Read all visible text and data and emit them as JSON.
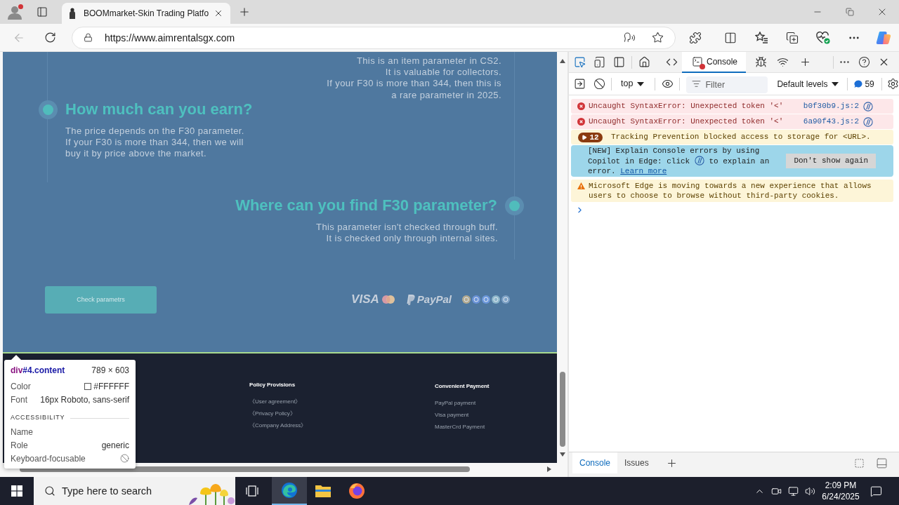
{
  "browser": {
    "tabs": [
      {
        "title": "BOOMmarket-Skin Trading Platfo",
        "selected": true
      }
    ],
    "url": "https://www.aimrentalsgx.com"
  },
  "page": {
    "intro": [
      "This is an item parameter in CS2.",
      "It is valuable for collectors.",
      "If your F30 is more than 344, then this is",
      "a rare parameter in 2025."
    ],
    "sections": [
      {
        "kind": "left",
        "title": "How much can you earn?",
        "lines": [
          "The price depends on the F30 parameter.",
          "If your F30 is more than 344, then we will",
          "buy it by price above the market."
        ]
      },
      {
        "kind": "right",
        "title": "Where can you find F30 parameter?",
        "lines": [
          "This parameter isn't checked through buff.",
          "It is checked only through internal sites."
        ]
      }
    ],
    "button": "Check parametrs",
    "payment_logos": [
      {
        "kind": "visa",
        "label": "VISA"
      },
      {
        "kind": "mastercard"
      },
      {
        "kind": "paypal",
        "label": "PayPal"
      },
      {
        "kind": "crypto"
      }
    ],
    "footer": [
      {
        "title": "Policy Provisions",
        "links": [
          "《User agreement》",
          "《Privacy Policy》",
          "《Company Address》"
        ]
      },
      {
        "title": "Convenient Payment",
        "links": [
          "PayPal payment",
          "Visa payment",
          "MasterCrd Payment"
        ]
      }
    ]
  },
  "inspect_tooltip": {
    "tag": "div",
    "selector": "#4.content",
    "size": "789 × 603",
    "styles": [
      {
        "label": "Color",
        "value": "#FFFFFF",
        "kind": "swatch"
      },
      {
        "label": "Font",
        "value": "16px Roboto, sans-serif",
        "kind": "text"
      }
    ],
    "section": "ACCESSIBILITY",
    "accessibility": [
      {
        "label": "Name",
        "kind": "text"
      },
      {
        "label": "Role",
        "value": "generic",
        "kind": "text"
      },
      {
        "label": "Keyboard-focusable",
        "kind": "blocked"
      }
    ]
  },
  "devtools": {
    "tabs": [
      {
        "label": "Console",
        "selected": true
      }
    ],
    "context": "top",
    "filter": {
      "placeholder": "Filter"
    },
    "levels": "Default levels",
    "message_count": "59",
    "messages": [
      {
        "kind": "error",
        "text": "Uncaught SyntaxError: Unexpected token '<'",
        "source": "b0f30b9.js:2"
      },
      {
        "kind": "error",
        "text": "Uncaught SyntaxError: Unexpected token '<'",
        "source": "6a90f43.js:2"
      },
      {
        "kind": "group",
        "count": "12",
        "text": "Tracking Prevention blocked access to storage for <URL>."
      },
      {
        "kind": "promo",
        "text": "[NEW] Explain Console errors by using Copilot in Edge: click",
        "text_after": "to explain an error.",
        "link": "Learn more",
        "button": "Don't show again"
      },
      {
        "kind": "warning",
        "text": "Microsoft Edge is moving towards a new experience that allows users to choose to browse without third-party cookies."
      }
    ],
    "drawer_tabs": [
      {
        "label": "Console",
        "selected": true
      },
      {
        "label": "Issues",
        "selected": false
      }
    ]
  },
  "taskbar": {
    "search": {
      "placeholder": "Type here to search"
    },
    "time": "2:09 PM",
    "date": "6/24/2025"
  }
}
